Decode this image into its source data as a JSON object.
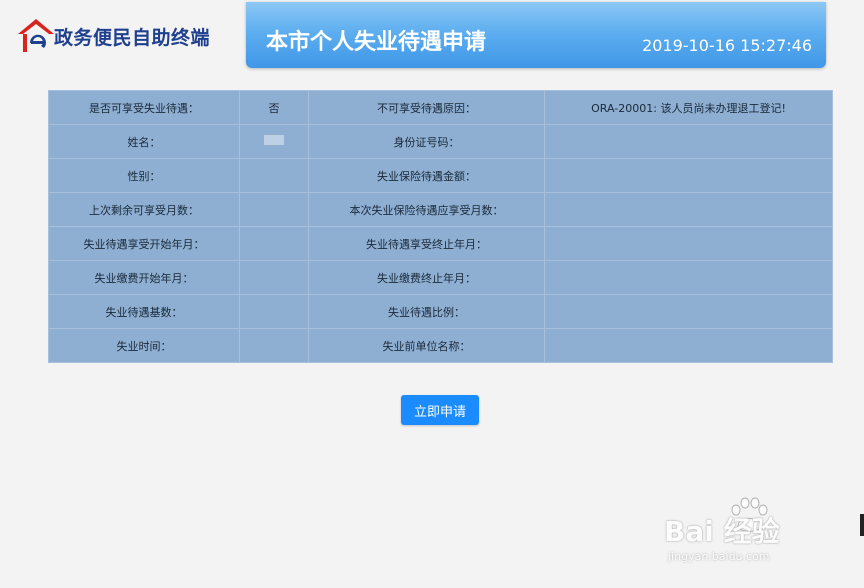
{
  "brand": {
    "name": "政务便民自助终端"
  },
  "header": {
    "title": "本市个人失业待遇申请",
    "datetime": "2019-10-16 15:27:46"
  },
  "table": {
    "rows": [
      {
        "label1": "是否可享受失业待遇：",
        "value1": "否",
        "label2": "不可享受待遇原因：",
        "value2": "ORA-20001: 该人员尚未办理退工登记!"
      },
      {
        "label1": "姓名：",
        "value1": "",
        "label2": "身份证号码：",
        "value2": ""
      },
      {
        "label1": "性别：",
        "value1": "",
        "label2": "失业保险待遇金额：",
        "value2": ""
      },
      {
        "label1": "上次剩余可享受月数：",
        "value1": "",
        "label2": "本次失业保险待遇应享受月数：",
        "value2": ""
      },
      {
        "label1": "失业待遇享受开始年月：",
        "value1": "",
        "label2": "失业待遇享受终止年月：",
        "value2": ""
      },
      {
        "label1": "失业缴费开始年月：",
        "value1": "",
        "label2": "失业缴费终止年月：",
        "value2": ""
      },
      {
        "label1": "失业待遇基数：",
        "value1": "",
        "label2": "失业待遇比例：",
        "value2": ""
      },
      {
        "label1": "失业时间：",
        "value1": "",
        "label2": "失业前单位名称：",
        "value2": ""
      }
    ]
  },
  "actions": {
    "apply_label": "立即申请"
  },
  "watermark": {
    "main": "Bai 经验",
    "sub": "jingyan.baidu.com"
  },
  "colors": {
    "accent": "#1a8cff",
    "header": "#5eaef0",
    "table_bg": "#8eaed2",
    "brand": "#1f3f8f",
    "logo_red": "#d9231d"
  }
}
